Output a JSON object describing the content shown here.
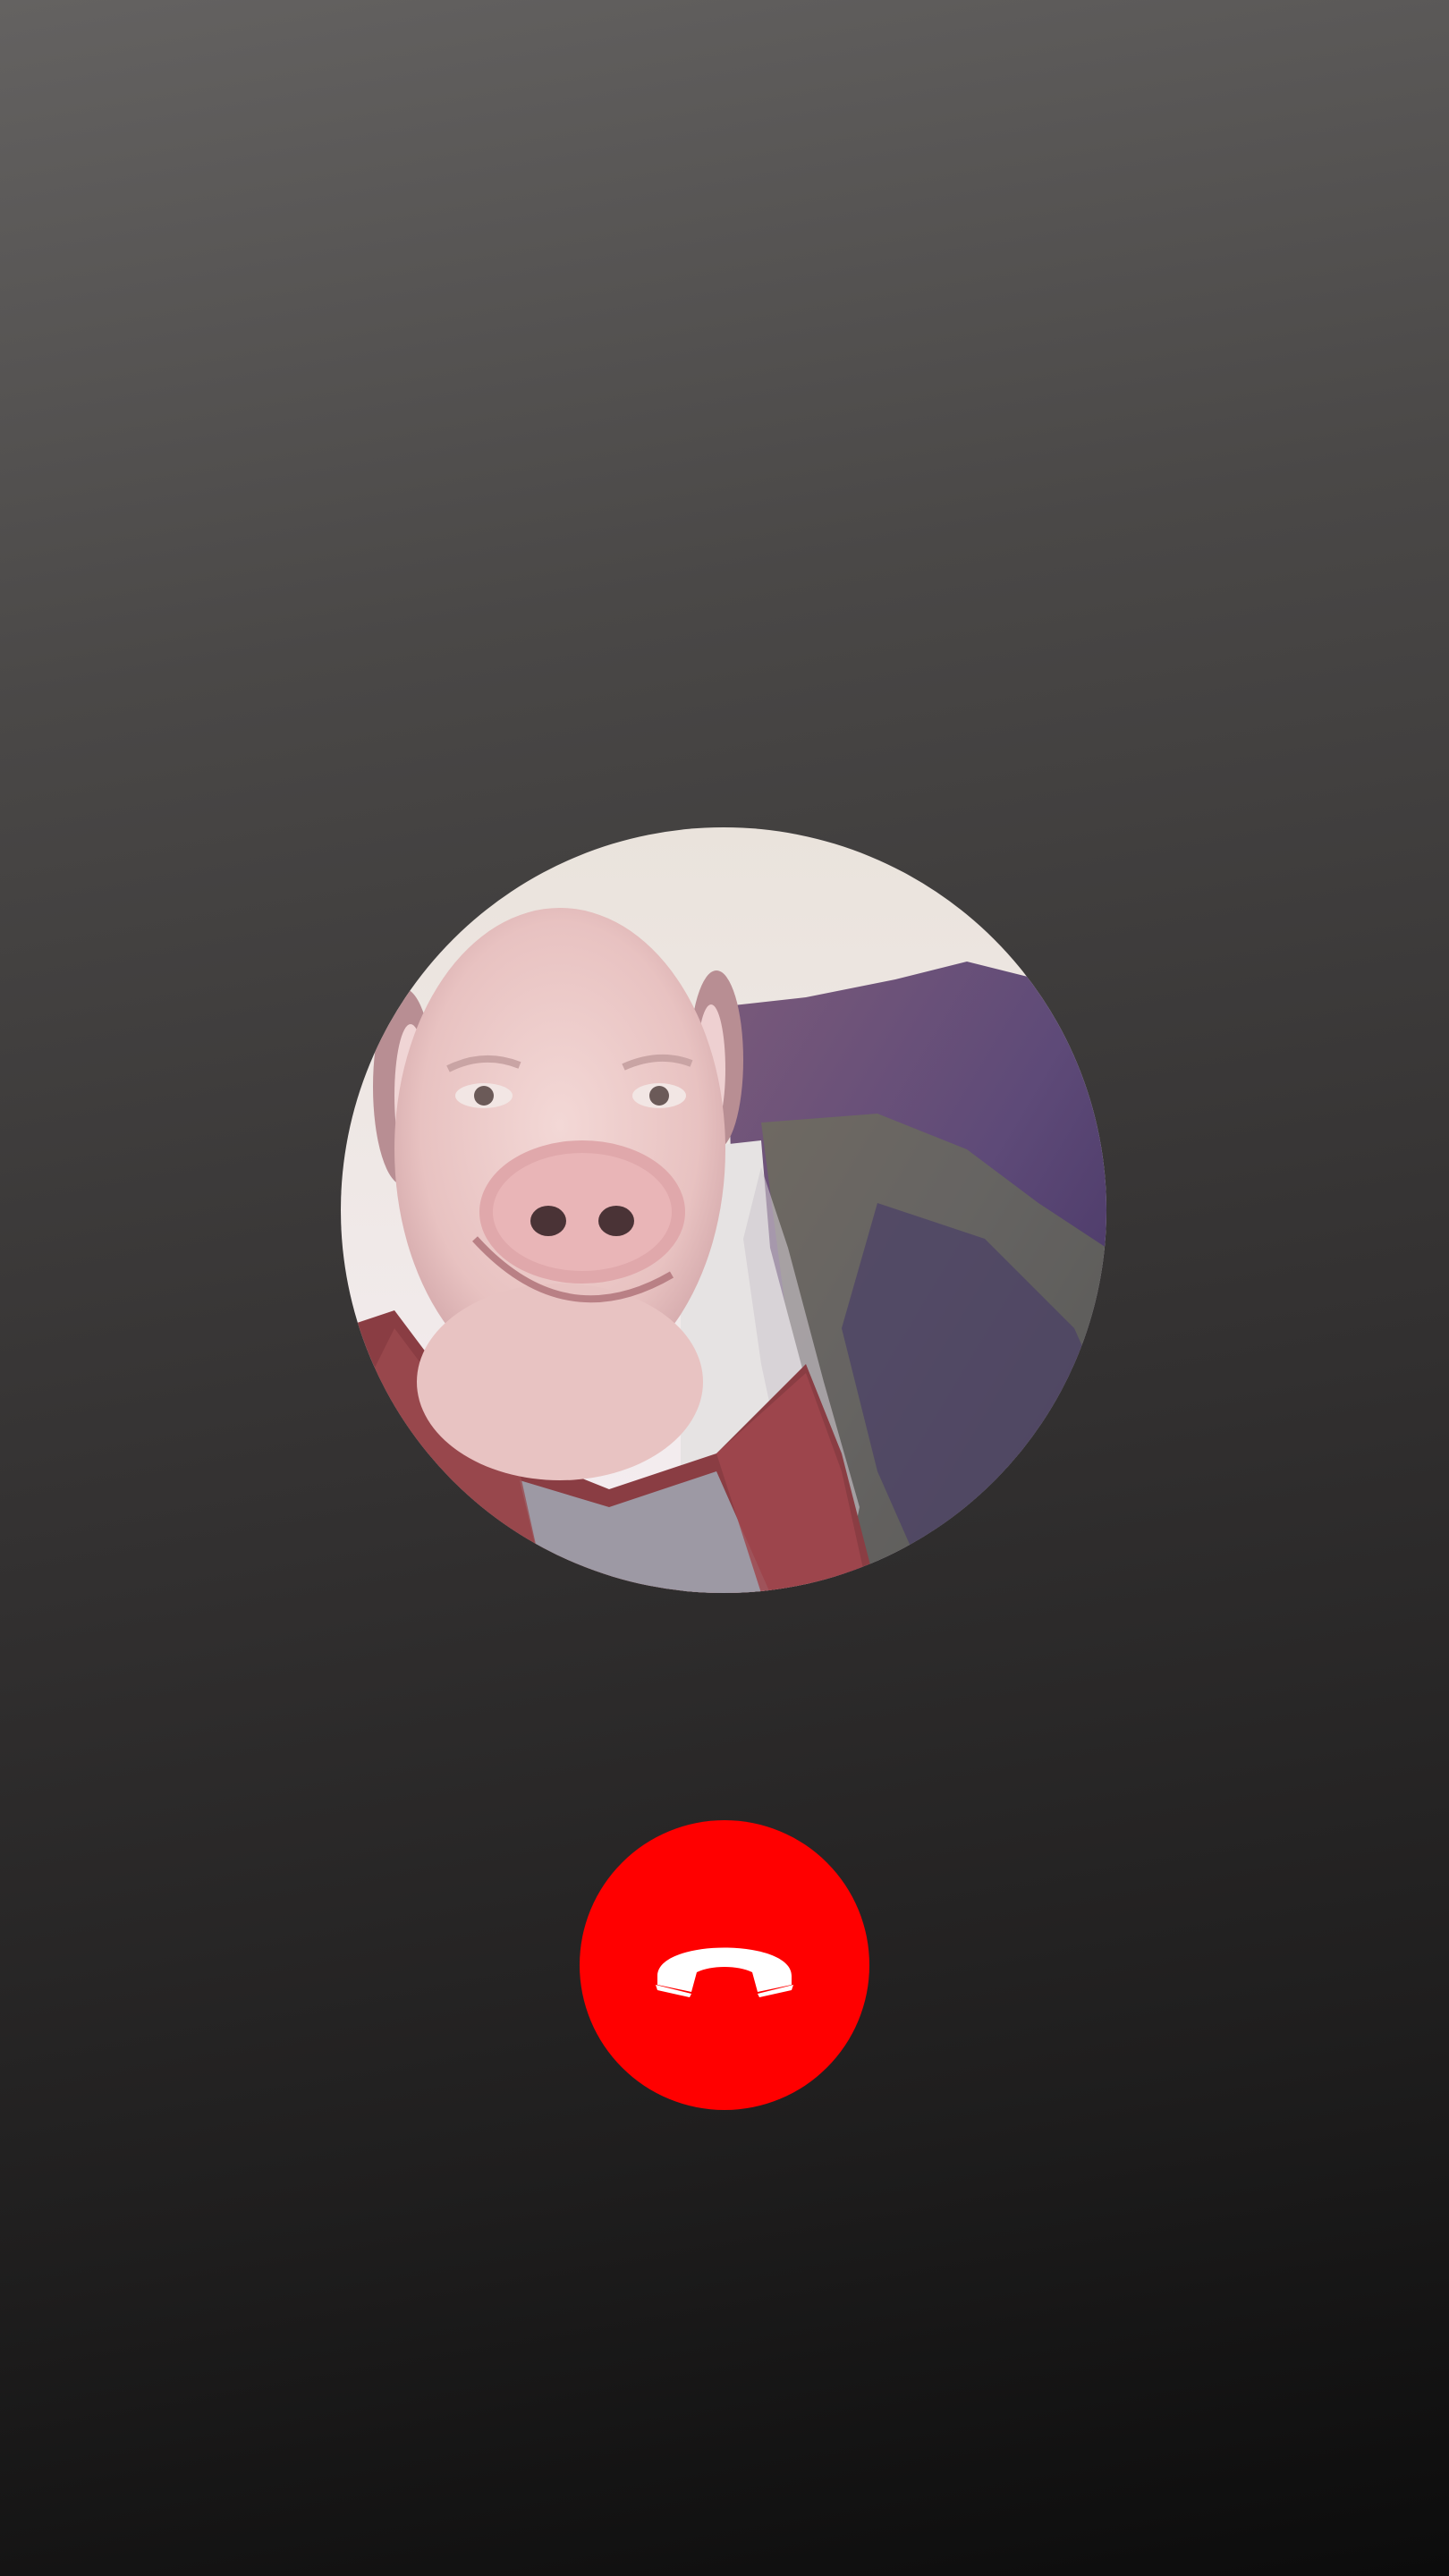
{
  "call": {
    "caller_avatar": {
      "alt": "",
      "icon": "avatar-photo-pig-face"
    },
    "end_call": {
      "icon": "phone-hangup-icon",
      "background_color": "#ff0000",
      "icon_color": "#ffffff"
    }
  },
  "colors": {
    "background_top": "#646261",
    "background_bottom": "#0c0c0c"
  }
}
